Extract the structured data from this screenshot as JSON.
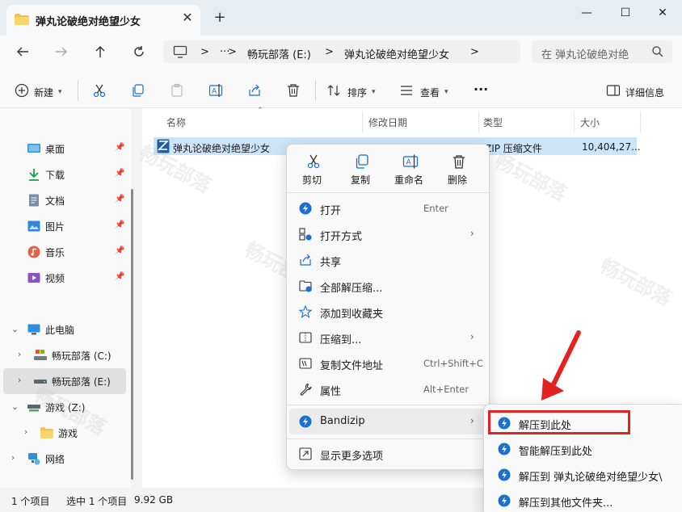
{
  "window": {
    "tab_title": "弹丸论破绝对绝望少女",
    "new_tab": "+",
    "close_tab": "✕",
    "minimize": "—",
    "maximize": "☐",
    "close": "✕"
  },
  "address": {
    "dots": "···",
    "crumbs": [
      "畅玩部落 (E:)",
      "弹丸论破绝对绝望少女"
    ],
    "search_placeholder": "在 弹丸论破绝对绝"
  },
  "toolbar": {
    "new_label": "新建",
    "sort_label": "排序",
    "view_label": "查看",
    "more": "···",
    "details_label": "详细信息"
  },
  "sidebar": {
    "quick": [
      {
        "label": "桌面",
        "icon": "desktop-icon"
      },
      {
        "label": "下载",
        "icon": "download-icon"
      },
      {
        "label": "文档",
        "icon": "document-icon"
      },
      {
        "label": "图片",
        "icon": "picture-icon"
      },
      {
        "label": "音乐",
        "icon": "music-icon"
      },
      {
        "label": "视频",
        "icon": "video-icon"
      }
    ],
    "this_pc": "此电脑",
    "drive_c": "畅玩部落 (C:)",
    "drive_e": "畅玩部落 (E:)",
    "drive_z": "游戏 (Z:)",
    "folder_games": "游戏",
    "network": "网络"
  },
  "columns": {
    "name": "名称",
    "date": "修改日期",
    "type": "类型",
    "size": "大小"
  },
  "file": {
    "name": "弹丸论破绝对绝望少女",
    "type": "ZIP 压缩文件",
    "size": "10,404,27..."
  },
  "context_menu": {
    "quick_actions": [
      "剪切",
      "复制",
      "重命名",
      "删除"
    ],
    "items": [
      {
        "label": "打开",
        "shortcut": "Enter"
      },
      {
        "label": "打开方式",
        "submenu": true
      },
      {
        "label": "共享"
      },
      {
        "label": "全部解压缩..."
      },
      {
        "label": "添加到收藏夹"
      },
      {
        "label": "压缩到...",
        "submenu": true
      },
      {
        "label": "复制文件地址",
        "shortcut": "Ctrl+Shift+C"
      },
      {
        "label": "属性",
        "shortcut": "Alt+Enter"
      },
      {
        "label": "Bandizip",
        "submenu": true
      },
      {
        "label": "显示更多选项"
      }
    ]
  },
  "bandizip_submenu": [
    "解压到此处",
    "智能解压到此处",
    "解压到 弹丸论破绝对绝望少女\\",
    "解压到其他文件夹..."
  ],
  "status": {
    "count": "1 个项目",
    "selected": "选中 1 个项目",
    "size": "9.92 GB"
  },
  "watermark": "畅玩部落",
  "colors": {
    "selection": "#cce4f7",
    "highlight": "#e52222",
    "bandizip": "#1a6fd4",
    "folder": "#f6c244"
  }
}
